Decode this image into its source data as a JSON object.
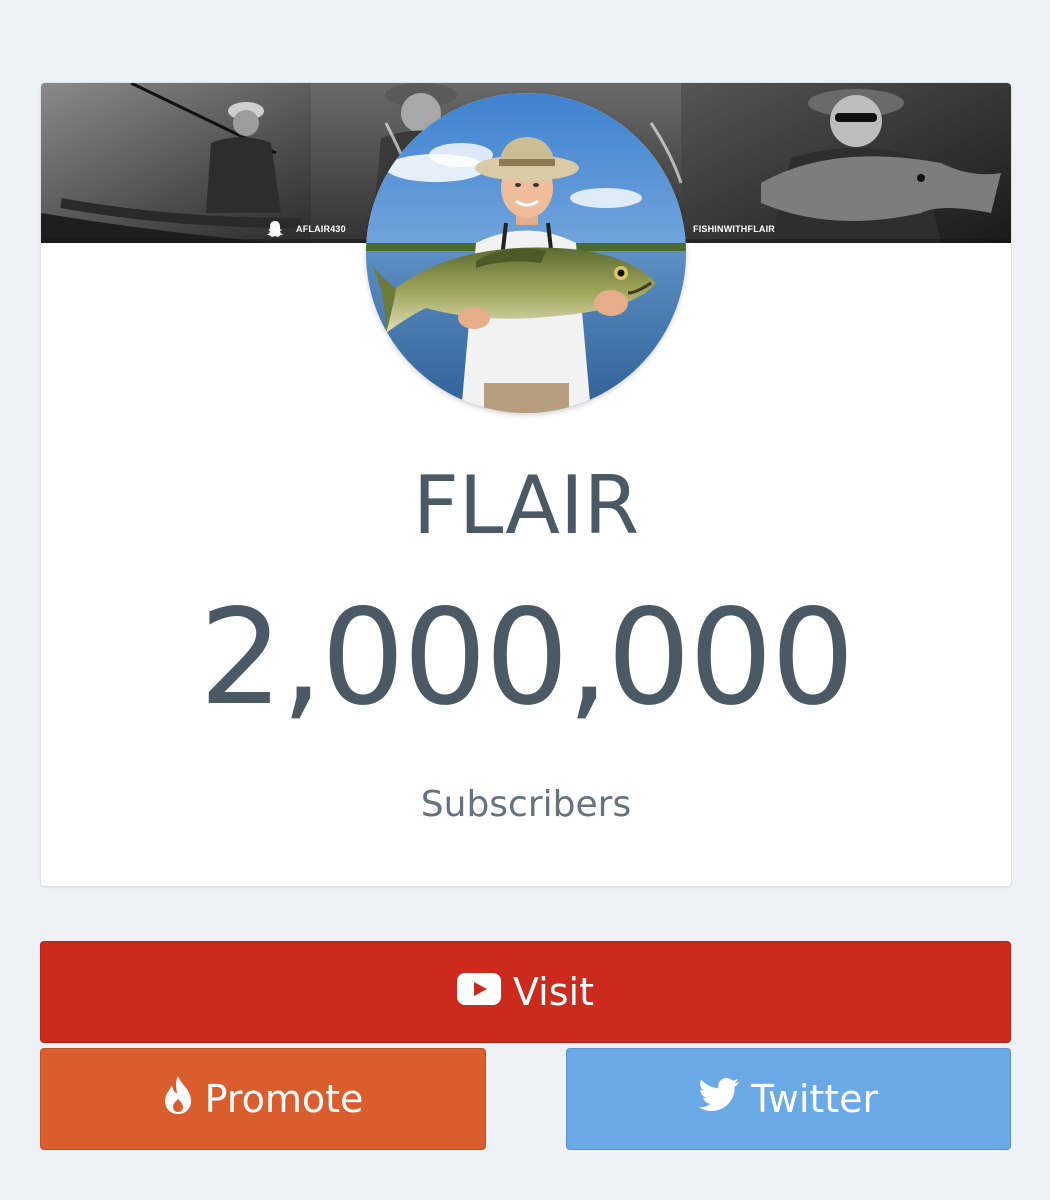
{
  "channel": {
    "name": "FLAIR",
    "subscriber_count": "2,000,000",
    "subscriber_label": "Subscribers"
  },
  "banner": {
    "handle_left": "AFLAIR430",
    "handle_right": "FISHINWITHFLAIR"
  },
  "buttons": {
    "visit_label": "Visit",
    "promote_label": "Promote",
    "twitter_label": "Twitter"
  },
  "colors": {
    "visit": "#cc2a1c",
    "promote": "#d95d2d",
    "twitter": "#6aa8e6",
    "text": "#4a5964",
    "background": "#eef2f6"
  },
  "icons": {
    "visit": "youtube-icon",
    "promote": "flame-icon",
    "twitter": "twitter-bird-icon",
    "banner_left": "snapchat-ghost-icon"
  }
}
